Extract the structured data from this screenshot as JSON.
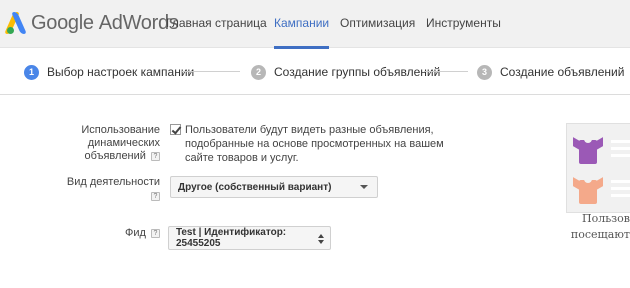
{
  "header": {
    "logo_google": "Google",
    "logo_adwords": "AdWords",
    "nav": [
      {
        "label": "Главная страница",
        "active": false
      },
      {
        "label": "Кампании",
        "active": true
      },
      {
        "label": "Оптимизация",
        "active": false
      },
      {
        "label": "Инструменты",
        "active": false
      }
    ],
    "accent_color": "#3f6fc3"
  },
  "stepper": {
    "steps": [
      {
        "number": "1",
        "label": "Выбор настроек кампании",
        "active": true
      },
      {
        "number": "2",
        "label": "Создание группы объявлений",
        "active": false
      },
      {
        "number": "3",
        "label": "Создание объявлений",
        "active": false
      }
    ]
  },
  "form": {
    "dynamic_ads": {
      "label_line1": "Использование",
      "label_line2": "динамических",
      "label_line3": "объявлений",
      "help": "?",
      "checked": true,
      "checkbox_text": "Пользователи будут видеть разные объявления, подобранные на основе просмотренных на вашем сайте товаров и услуг."
    },
    "business_type": {
      "label": "Вид деятельности",
      "help": "?",
      "value": "Другое (собственный вариант)"
    },
    "feed": {
      "label": "Фид",
      "help": "?",
      "value": "Test | Идентификатор: 25455205"
    }
  },
  "preview": {
    "caption_line1": "Пользов",
    "caption_line2": "посещают",
    "shirt_colors": [
      "#9b59b6",
      "#f4a98a"
    ]
  }
}
